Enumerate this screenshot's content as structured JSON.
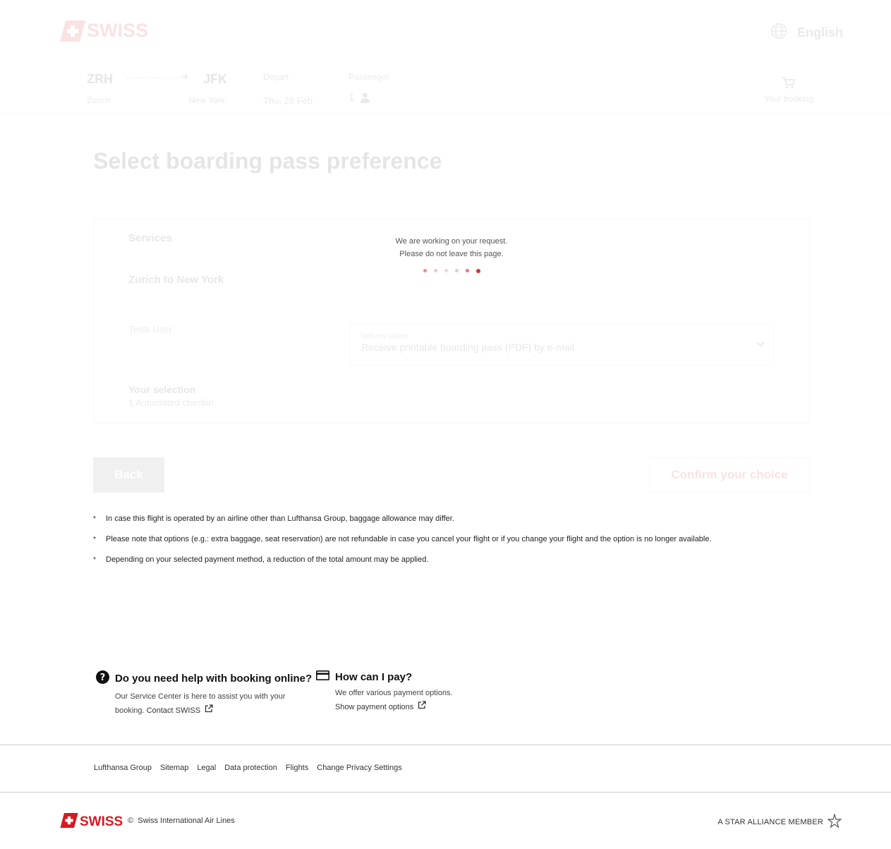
{
  "header": {
    "brand": "SWISS",
    "language": "English"
  },
  "trip": {
    "origin_code": "ZRH",
    "origin_city": "Zurich",
    "dest_code": "JFK",
    "dest_city": "New York",
    "depart_label": "Depart",
    "depart_value": "Thu, 20 Feb",
    "passenger_label": "Passenger",
    "passenger_value": "1",
    "booking_label": "Your booking"
  },
  "page": {
    "title": "Select boarding pass preference"
  },
  "panel": {
    "services_label": "Services",
    "route_label": "Zurich to New York",
    "passenger_name": "Testk User",
    "delivery_label": "Delivery option",
    "delivery_value": "Receive printable boarding pass (PDF) by e-mail",
    "selection_label": "Your selection",
    "selection_value": "1 Automated checkin"
  },
  "loading": {
    "line1": "We are working on your request.",
    "line2": "Please do not leave this page."
  },
  "buttons": {
    "back": "Back",
    "confirm": "Confirm your choice"
  },
  "notes": [
    "In case this flight is operated by an airline other than Lufthansa Group, baggage allowance may differ.",
    "Please note that options (e.g.: extra baggage, seat reservation) are not refundable in case you cancel your flight or if you change your flight and the option is no longer available.",
    "Depending on your selected payment method, a reduction of the total amount may be applied."
  ],
  "note_marker": "*",
  "help": {
    "booking_title": "Do you need help with booking online?",
    "booking_body": "Our Service Center is here to assist you with your",
    "booking_body2": "booking.",
    "booking_link": "Contact SWISS",
    "pay_title": "How can I pay?",
    "pay_body": "We offer various payment options.",
    "pay_link": "Show payment options"
  },
  "footer": {
    "links": [
      "Lufthansa Group",
      "Sitemap",
      "Legal",
      "Data protection",
      "Flights",
      "Change Privacy Settings"
    ],
    "brand": "SWISS",
    "copyright_symbol": "©",
    "copyright": "Swiss International Air Lines",
    "star_alliance": "A STAR ALLIANCE MEMBER"
  },
  "colors": {
    "brand_red": "#d71920"
  }
}
